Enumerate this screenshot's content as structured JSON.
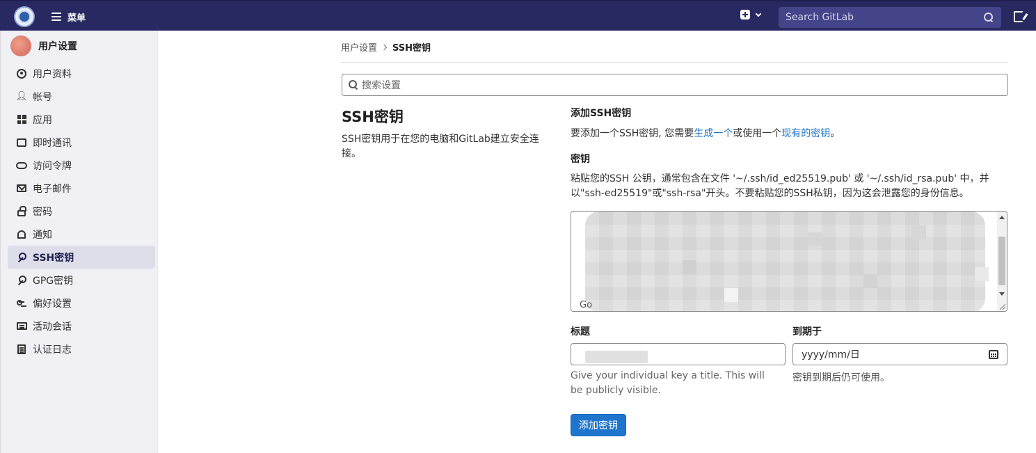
{
  "topbar": {
    "menu_label": "菜单",
    "search_placeholder": "Search GitLab",
    "colors": {
      "navbar": "#292961",
      "search_bg": "#44448a"
    }
  },
  "sidebar": {
    "title": "用户设置",
    "items": [
      {
        "label": "用户资料",
        "icon": "profile-icon"
      },
      {
        "label": "帐号",
        "icon": "account-icon"
      },
      {
        "label": "应用",
        "icon": "applications-icon"
      },
      {
        "label": "即时通讯",
        "icon": "chat-icon"
      },
      {
        "label": "访问令牌",
        "icon": "token-icon"
      },
      {
        "label": "电子邮件",
        "icon": "mail-icon"
      },
      {
        "label": "密码",
        "icon": "lock-icon"
      },
      {
        "label": "通知",
        "icon": "bell-icon"
      },
      {
        "label": "SSH密钥",
        "icon": "key-icon",
        "active": true
      },
      {
        "label": "GPG密钥",
        "icon": "key-icon"
      },
      {
        "label": "偏好设置",
        "icon": "preferences-icon"
      },
      {
        "label": "活动会话",
        "icon": "monitor-icon"
      },
      {
        "label": "认证日志",
        "icon": "log-icon"
      }
    ]
  },
  "breadcrumb": {
    "parent": "用户设置",
    "current": "SSH密钥"
  },
  "settings_search": {
    "placeholder": "搜索设置"
  },
  "section": {
    "title": "SSH密钥",
    "description": "SSH密钥用于在您的电脑和GitLab建立安全连接。"
  },
  "add_key": {
    "title": "添加SSH密钥",
    "desc_prefix": "要添加一个SSH密钥, 您需要",
    "desc_link1": "生成一个",
    "desc_middle": "或使用一个",
    "desc_link2": "现有的密钥",
    "desc_suffix": "。",
    "key_label": "密钥",
    "key_help": "粘贴您的SSH 公钥，通常包含在文件 '~/.ssh/id_ed25519.pub' 或 '~/.ssh/id_rsa.pub' 中，并以\"ssh-ed25519\"或\"ssh-rsa\"开头。不要粘贴您的SSH私钥，因为这会泄露您的身份信息。",
    "key_fragment": "Go",
    "title_label": "标题",
    "title_help": "Give your individual key a title. This will be publicly visible.",
    "expires_label": "到期于",
    "expires_placeholder": "yyyy/mm/日",
    "expires_help": "密钥到期后仍可使用。",
    "submit_label": "添加密钥",
    "colors": {
      "primary": "#1f75cb",
      "link": "#1f75cb"
    }
  }
}
